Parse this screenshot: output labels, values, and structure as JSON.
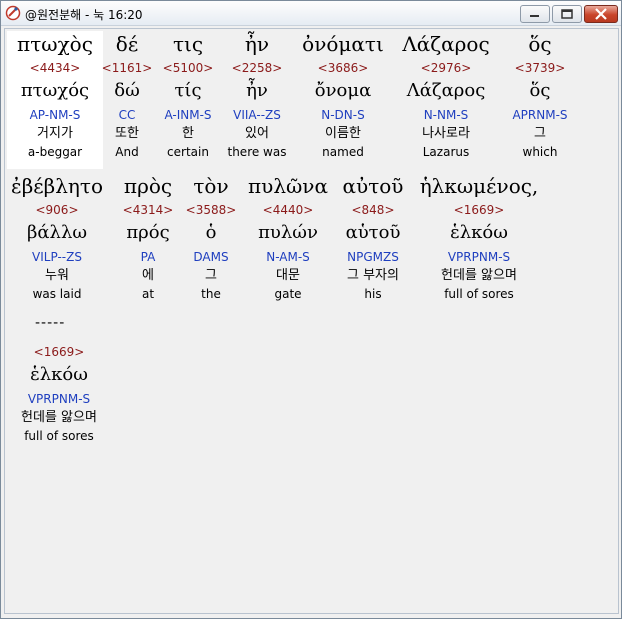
{
  "window": {
    "title": "@원전분해 - 눅 16:20"
  },
  "rows": [
    [
      {
        "greek": "πτωχὸς",
        "strong": "<4434>",
        "lemma": "πτωχός",
        "parse": "AP-NM-S",
        "korean": "거지가",
        "english": "a-beggar"
      },
      {
        "greek": "δέ",
        "strong": "<1161>",
        "lemma": "δώ",
        "parse": "CC",
        "korean": "또한",
        "english": "And"
      },
      {
        "greek": "τις",
        "strong": "<5100>",
        "lemma": "τίς",
        "parse": "A-INM-S",
        "korean": "한",
        "english": "certain"
      },
      {
        "greek": "ἦν",
        "strong": "<2258>",
        "lemma": "ἦν",
        "parse": "VIIA--ZS",
        "korean": "있어",
        "english": "there was"
      },
      {
        "greek": "ὀνόματι",
        "strong": "<3686>",
        "lemma": "ὄνομα",
        "parse": "N-DN-S",
        "korean": "이름한",
        "english": "named"
      },
      {
        "greek": "Λάζαρος",
        "strong": "<2976>",
        "lemma": "Λάζαρος",
        "parse": "N-NM-S",
        "korean": "나사로라",
        "english": "Lazarus"
      },
      {
        "greek": "ὅς",
        "strong": "<3739>",
        "lemma": "ὅς",
        "parse": "APRNM-S",
        "korean": "그",
        "english": "which"
      }
    ],
    [
      {
        "greek": "ἐβέβλητο",
        "strong": "<906>",
        "lemma": "βάλλω",
        "parse": "VILP--ZS",
        "korean": "누워",
        "english": "was laid"
      },
      {
        "greek": "πρὸς",
        "strong": "<4314>",
        "lemma": "πρός",
        "parse": "PA",
        "korean": "에",
        "english": "at"
      },
      {
        "greek": "τὸν",
        "strong": "<3588>",
        "lemma": "ὁ",
        "parse": "DAMS",
        "korean": "그",
        "english": "the"
      },
      {
        "greek": "πυλῶνα",
        "strong": "<4440>",
        "lemma": "πυλών",
        "parse": "N-AM-S",
        "korean": "대문",
        "english": "gate"
      },
      {
        "greek": "αὐτοῦ",
        "strong": "<848>",
        "lemma": "αὑτοῦ",
        "parse": "NPGMZS",
        "korean": "그 부자의",
        "english": "his"
      },
      {
        "greek": "ἡλκωμένος,",
        "strong": "<1669>",
        "lemma": "ἑλκόω",
        "parse": "VPRPNM-S",
        "korean": "헌데를 앓으며",
        "english": "full of sores"
      }
    ]
  ],
  "separator": "-----",
  "extra": {
    "strong": "<1669>",
    "lemma": "ἑλκόω",
    "parse": "VPRPNM-S",
    "korean": "헌데를 앓으며",
    "english": "full of sores"
  }
}
